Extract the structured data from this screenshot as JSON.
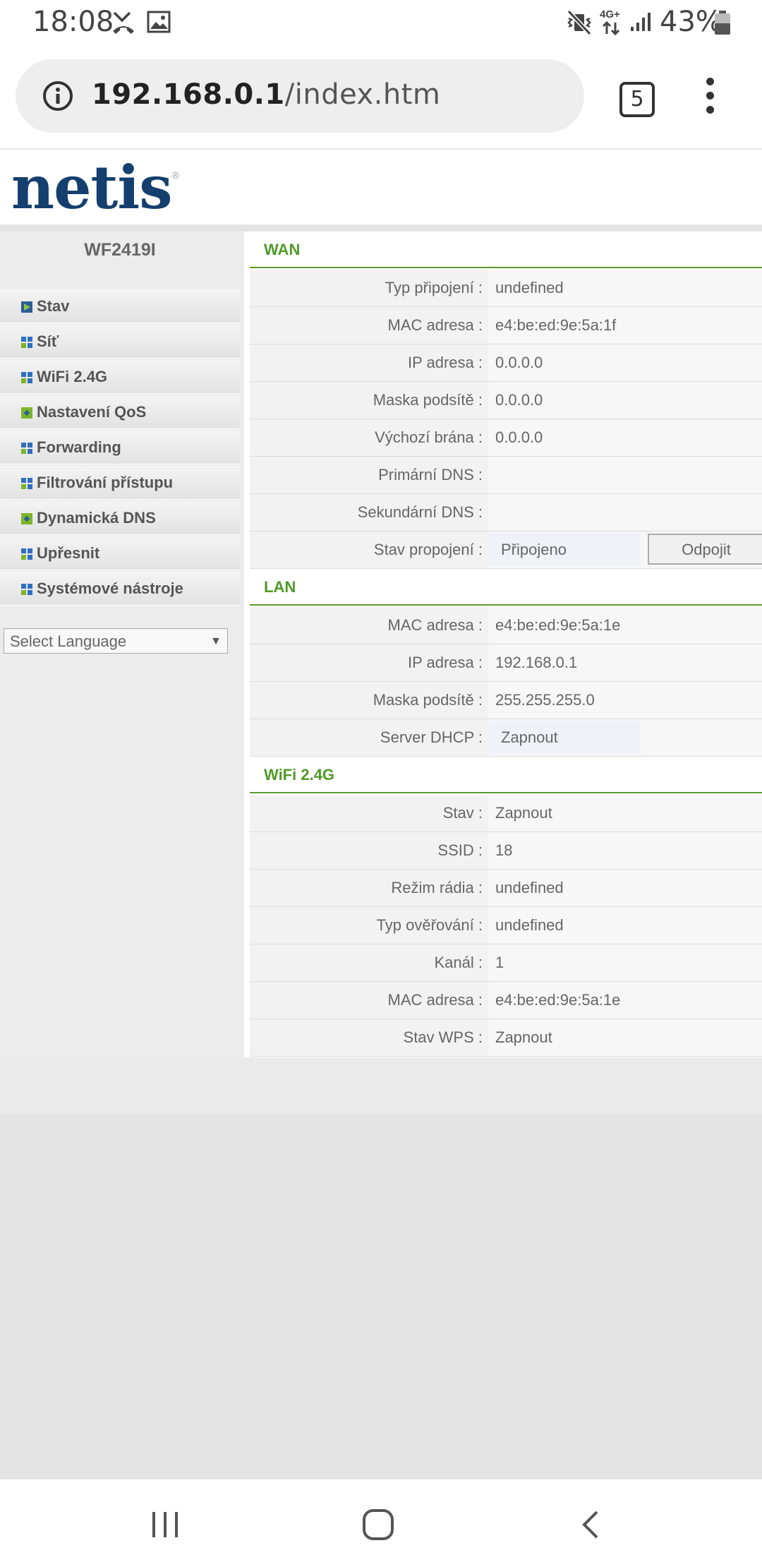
{
  "statusbar": {
    "time": "18:08",
    "network": "4G+",
    "battery": "43%"
  },
  "browser": {
    "url_host": "192.168.0.1",
    "url_path": "/index.htm",
    "tab_count": "5"
  },
  "header": {
    "logo": "netis",
    "logo_mark": "®"
  },
  "sidebar": {
    "model": "WF2419I",
    "items": [
      {
        "label": "Stav",
        "icon": "play-icon"
      },
      {
        "label": "Síť",
        "icon": "grid-icon"
      },
      {
        "label": "WiFi 2.4G",
        "icon": "grid-icon"
      },
      {
        "label": "Nastavení QoS",
        "icon": "diamond-icon"
      },
      {
        "label": "Forwarding",
        "icon": "grid-icon"
      },
      {
        "label": "Filtrování přístupu",
        "icon": "grid-icon"
      },
      {
        "label": "Dynamická DNS",
        "icon": "diamond-icon"
      },
      {
        "label": "Upřesnit",
        "icon": "grid-icon"
      },
      {
        "label": "Systémové nástroje",
        "icon": "grid-icon"
      }
    ],
    "language": "Select Language"
  },
  "wan": {
    "title": "WAN",
    "rows": [
      {
        "label": "Typ připojení :",
        "value": "undefined"
      },
      {
        "label": "MAC adresa :",
        "value": "e4:be:ed:9e:5a:1f"
      },
      {
        "label": "IP adresa :",
        "value": "0.0.0.0"
      },
      {
        "label": "Maska podsítě :",
        "value": "0.0.0.0"
      },
      {
        "label": "Výchozí brána :",
        "value": "0.0.0.0"
      },
      {
        "label": "Primární DNS :",
        "value": ""
      },
      {
        "label": "Sekundární DNS :",
        "value": ""
      },
      {
        "label": "Stav propojení :",
        "value": "Připojeno"
      }
    ],
    "disconnect_label": "Odpojit"
  },
  "lan": {
    "title": "LAN",
    "rows": [
      {
        "label": "MAC adresa :",
        "value": "e4:be:ed:9e:5a:1e"
      },
      {
        "label": "IP adresa :",
        "value": "192.168.0.1"
      },
      {
        "label": "Maska podsítě :",
        "value": "255.255.255.0"
      },
      {
        "label": "Server DHCP :",
        "value": "Zapnout"
      }
    ]
  },
  "wifi": {
    "title": "WiFi 2.4G",
    "rows": [
      {
        "label": "Stav :",
        "value": "Zapnout"
      },
      {
        "label": "SSID :",
        "value": "18"
      },
      {
        "label": "Režim rádia :",
        "value": "undefined"
      },
      {
        "label": "Typ ověřování :",
        "value": "undefined"
      },
      {
        "label": "Kanál :",
        "value": "1"
      },
      {
        "label": "MAC adresa :",
        "value": "e4:be:ed:9e:5a:1e"
      },
      {
        "label": "Stav WPS :",
        "value": "Zapnout"
      }
    ]
  }
}
